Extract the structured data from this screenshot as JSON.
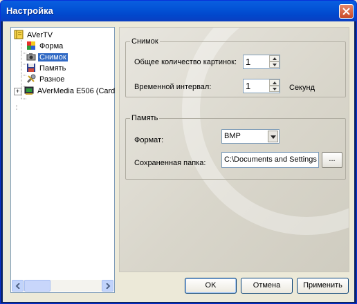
{
  "window": {
    "title": "Настройка"
  },
  "tree": {
    "items": [
      {
        "label": "AVerTV",
        "icon": "book-icon"
      },
      {
        "label": "Форма",
        "icon": "color-palette-icon"
      },
      {
        "label": "Снимок",
        "icon": "camera-icon",
        "selected": true
      },
      {
        "label": "Память",
        "icon": "floppy-disk-icon"
      },
      {
        "label": "Разное",
        "icon": "wrench-icon"
      },
      {
        "label": "AVerMedia E506 (Card",
        "icon": "tv-card-icon",
        "expander": "+"
      }
    ]
  },
  "snapshot": {
    "legend": "Снимок",
    "count_label": "Общее количество картинок:",
    "count_value": "1",
    "interval_label": "Временной интервал:",
    "interval_value": "1",
    "interval_unit": "Секунд"
  },
  "memory": {
    "legend": "Память",
    "format_label": "Формат:",
    "format_value": "BMP",
    "folder_label": "Сохраненная папка:",
    "folder_value": "C:\\Documents and Settings",
    "browse_label": "..."
  },
  "buttons": {
    "ok": "OK",
    "cancel": "Отмена",
    "apply": "Применить"
  },
  "colors": {
    "titlebar": "#0353d6",
    "selection": "#316ac5",
    "close": "#c94a28"
  }
}
